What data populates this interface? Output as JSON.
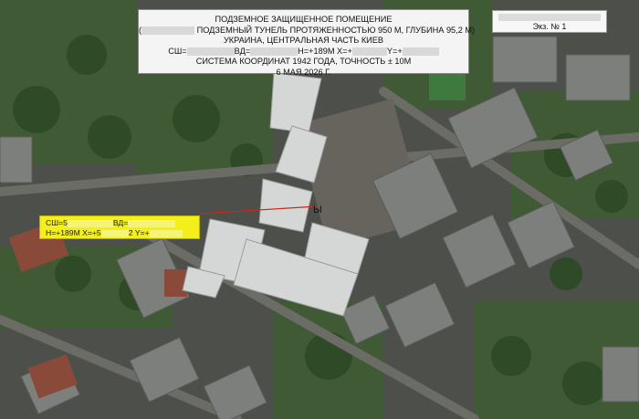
{
  "header": {
    "line1": "ПОДЗЕМНОЕ ЗАЩИЩЕННОЕ ПОМЕЩЕНИЕ",
    "line2_prefix": "(",
    "line2_text": "ПОДЗЕМНЫЙ ТУНЕЛЬ ПРОТЯЖЕННОСТЬЮ 950 М, ГЛУБИНА 95,2 М)",
    "line3": "УКРАИНА, ЦЕНТРАЛЬНАЯ ЧАСТЬ КИЕВ",
    "line4_a": "СШ=",
    "line4_b": "ВД=",
    "line4_c": "Н=+189М Х=+",
    "line4_d": "Y=+",
    "line5": "СИСТЕМА КООРДИНАТ 1942 ГОДА, ТОЧНОСТЬ ± 10М",
    "line6": "6 МАЯ 2026 Г."
  },
  "copy_label": "Экз. № 1",
  "coords": {
    "row1_a": "СШ=5",
    "row1_b": "ВД=",
    "row2_a": "Н=+189М Х=+5",
    "row2_b": "2 Y=+"
  },
  "map_marker": "Ы",
  "colors": {
    "info_bg": "#f4f4f4",
    "coord_bg": "#f2ef1b",
    "marker_line": "#c8281e"
  }
}
